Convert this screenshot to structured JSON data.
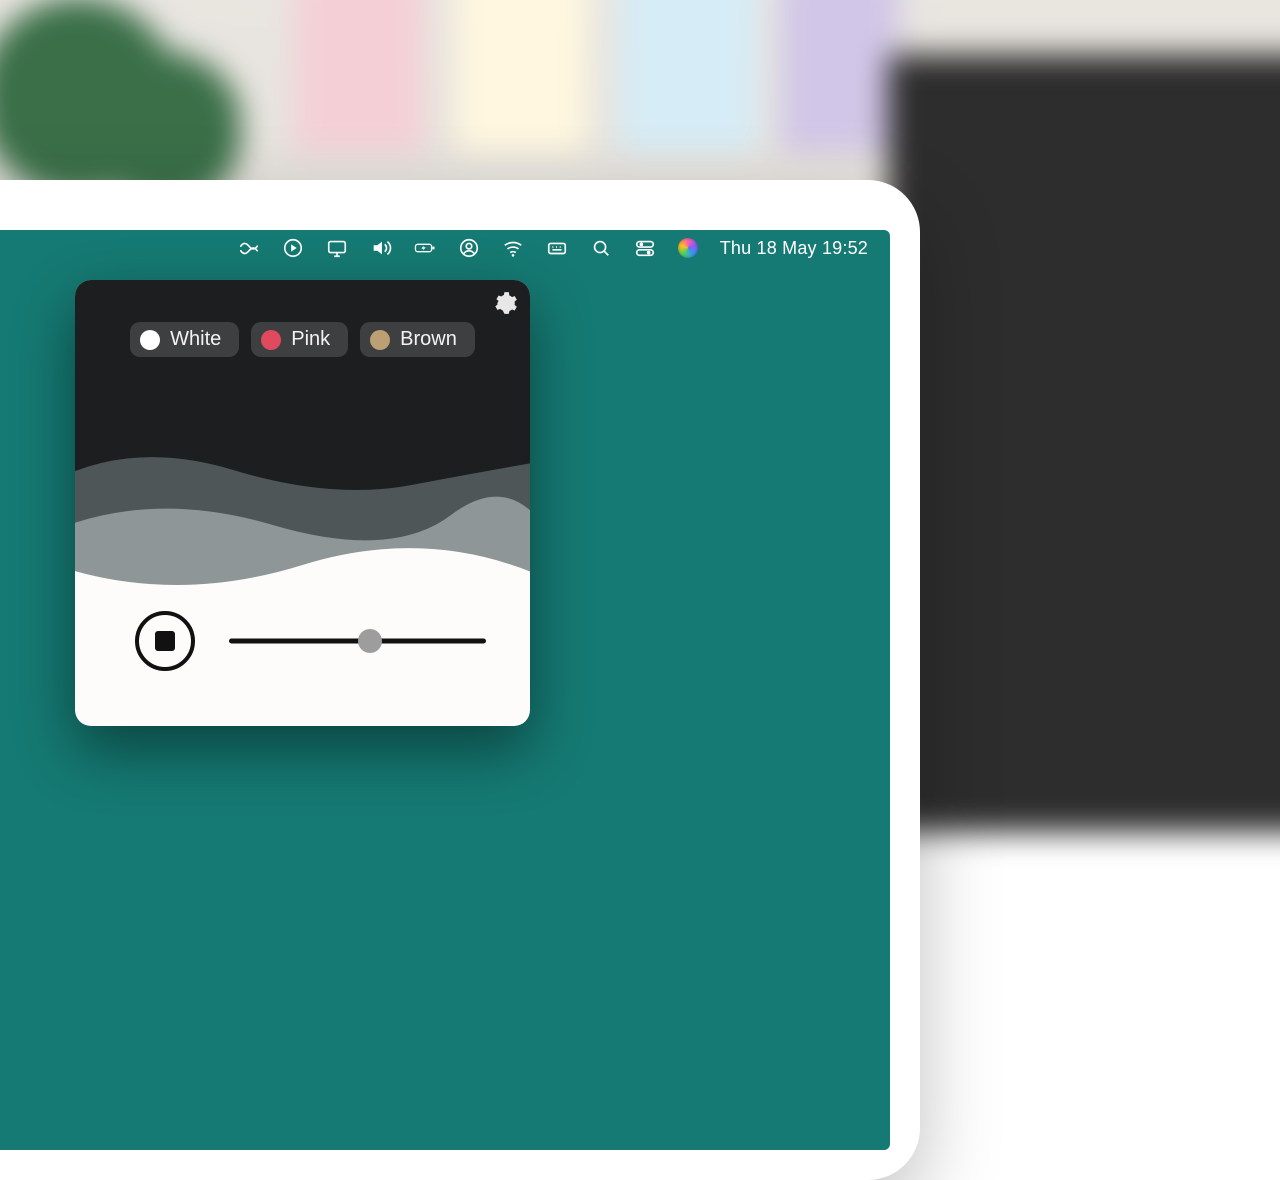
{
  "menubar": {
    "date_time": "Thu 18 May  19:52"
  },
  "panel": {
    "noise_options": [
      {
        "label": "White",
        "color": "#ffffff"
      },
      {
        "label": "Pink",
        "color": "#e04a5f"
      },
      {
        "label": "Brown",
        "color": "#bd9f74"
      }
    ],
    "volume_percent": 55
  }
}
